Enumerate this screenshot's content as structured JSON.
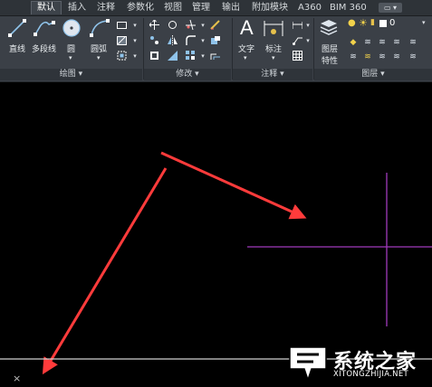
{
  "ribbon": {
    "tabs": [
      {
        "label": "默认",
        "active": true
      },
      {
        "label": "插入"
      },
      {
        "label": "注释"
      },
      {
        "label": "参数化"
      },
      {
        "label": "视图"
      },
      {
        "label": "管理"
      },
      {
        "label": "输出"
      },
      {
        "label": "附加模块"
      },
      {
        "label": "A360"
      },
      {
        "label": "BIM 360"
      }
    ],
    "tab_dropdown": "▭ ▾",
    "draw_panel": {
      "footer": "绘图 ▾",
      "tools": {
        "line": "直线",
        "polyline": "多段线",
        "circle": "圆",
        "arc": "圆弧"
      }
    },
    "modify_panel": {
      "footer": "修改 ▾"
    },
    "annotation_panel": {
      "footer": "注释 ▾",
      "tools": {
        "text": "文字",
        "dimension": "标注"
      }
    },
    "layers_panel": {
      "footer": "图层 ▾",
      "tools": {
        "layer_props_line1": "图层",
        "layer_props_line2": "特性",
        "current_layer": "0"
      }
    }
  },
  "canvas": {
    "background": "#000000",
    "crosshair_color": "#a13bbd",
    "arrow_color": "#ff3b3b",
    "ucs_x_label": "×"
  },
  "watermark": {
    "cn": "系统之家",
    "en": "XITONGZHIJIA.NET"
  }
}
